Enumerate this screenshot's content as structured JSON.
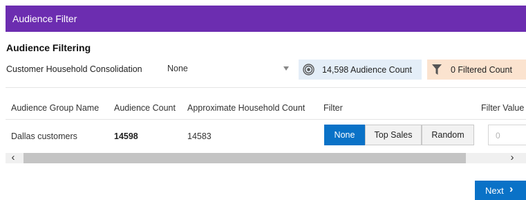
{
  "header": {
    "title": "Audience Filter"
  },
  "section": {
    "title": "Audience Filtering"
  },
  "consolidation": {
    "label": "Customer Household Consolidation",
    "selected": "None"
  },
  "audience_count": {
    "text": "14,598 Audience Count",
    "icon": "target-icon"
  },
  "filtered_count": {
    "text": "0 Filtered Count",
    "icon": "funnel-icon"
  },
  "table": {
    "columns": [
      "Audience Group Name",
      "Audience Count",
      "Approximate Household Count",
      "Filter",
      "Filter Value"
    ],
    "rows": [
      {
        "name": "Dallas customers",
        "audience_count": "14598",
        "household_count": "14583",
        "filter_options": [
          "None",
          "Top Sales",
          "Random"
        ],
        "filter_selected": "None",
        "filter_value_placeholder": "0"
      }
    ]
  },
  "scrollbar": {
    "left": "‹",
    "right": "›"
  },
  "footer": {
    "next_label": "Next",
    "next_icon": "chevron-right-icon"
  },
  "colors": {
    "header": "#6c2db0",
    "primary": "#0a72c7",
    "audience_badge": "#e4eef8",
    "filtered_badge": "#fbe3cf"
  }
}
